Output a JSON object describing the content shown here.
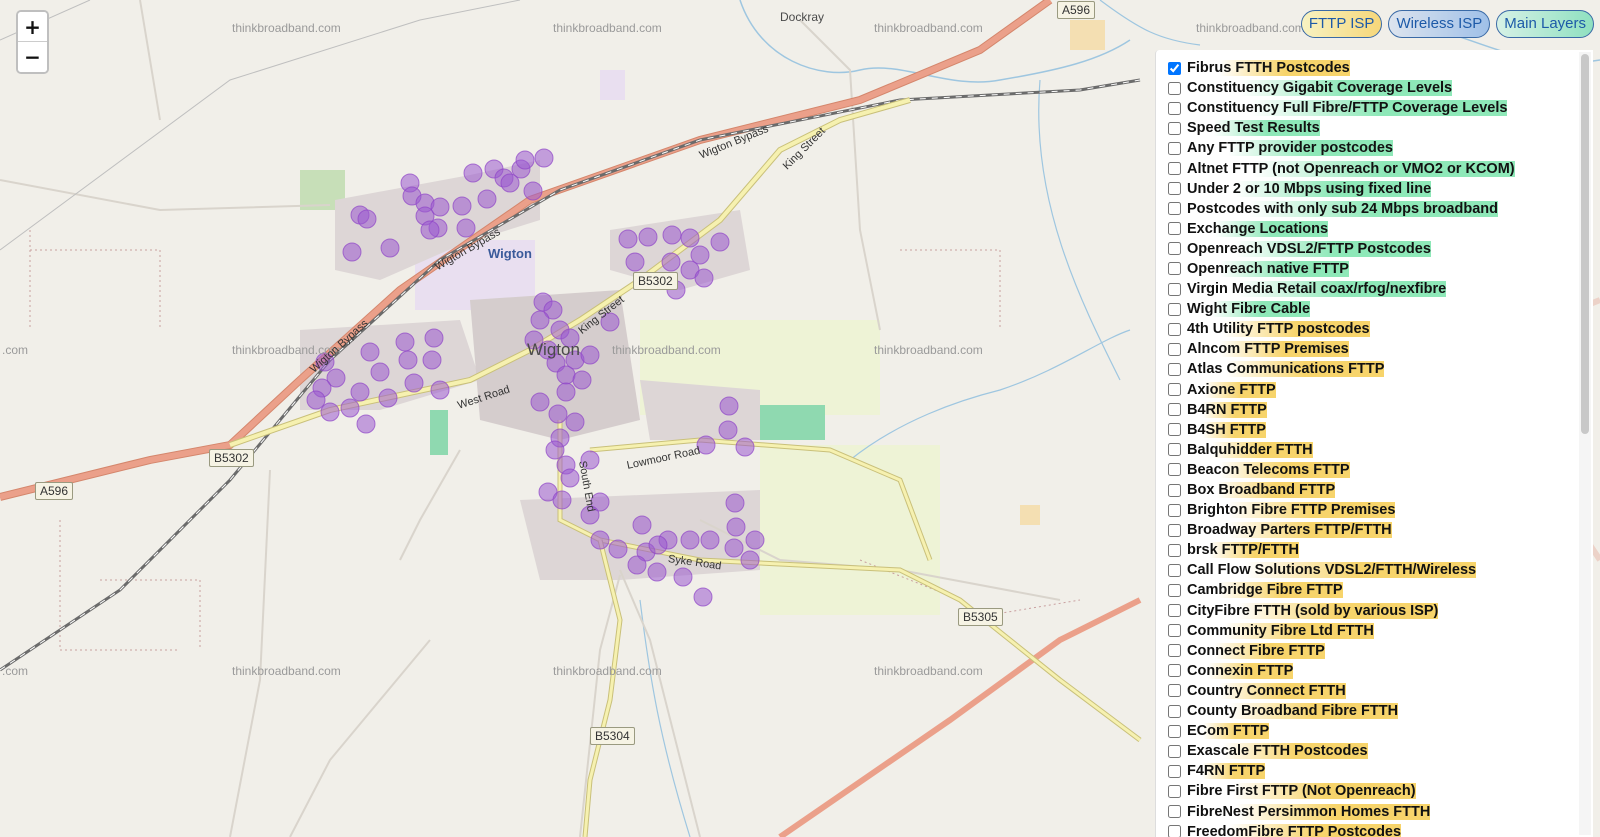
{
  "zoom": {
    "in_label": "+",
    "out_label": "−"
  },
  "tabs": [
    {
      "label": "FTTP ISP"
    },
    {
      "label": "Wireless ISP"
    },
    {
      "label": "Main Layers"
    }
  ],
  "map": {
    "watermark": "thinkbroadband.com",
    "watermark_partial": ".com",
    "places": {
      "town": "Wigton",
      "station": "Wigton",
      "dockray": "Dockray"
    },
    "roads": {
      "a596_north": "A596",
      "a596_west": "A596",
      "b5302_west": "B5302",
      "b5302_center": "B5302",
      "b5305": "B5305",
      "b5304": "B5304",
      "wigton_bypass_ne": "Wigton Bypass",
      "wigton_bypass_nw": "Wigton Bypass",
      "wigton_bypass_sw": "Wigton Bypass",
      "king_street": "King Street",
      "king_street_2": "King Street",
      "west_road": "West Road",
      "lowmoor_road": "Lowmoor Road",
      "south_end": "South End",
      "syke_road": "Syke Road"
    },
    "colors": {
      "marker": "#9b59d0",
      "road_main": "#e8937a",
      "road_minor": "#f6f1b0",
      "rail": "#6b6b6b"
    }
  },
  "layers": [
    {
      "label": "Fibrus FTTH Postcodes",
      "checked": true,
      "hl": "yellow"
    },
    {
      "label": "Constituency Gigabit Coverage Levels",
      "checked": false,
      "hl": "green"
    },
    {
      "label": "Constituency Full Fibre/FTTP Coverage Levels",
      "checked": false,
      "hl": "green"
    },
    {
      "label": "Speed Test Results",
      "checked": false,
      "hl": "green"
    },
    {
      "label": "Any FTTP provider postcodes",
      "checked": false,
      "hl": "green"
    },
    {
      "label": "Altnet FTTP (not Openreach or VMO2 or KCOM)",
      "checked": false,
      "hl": "green"
    },
    {
      "label": "Under 2 or 10 Mbps using fixed line",
      "checked": false,
      "hl": "green"
    },
    {
      "label": "Postcodes with only sub 24 Mbps broadband",
      "checked": false,
      "hl": "green"
    },
    {
      "label": "Exchange Locations",
      "checked": false,
      "hl": "green"
    },
    {
      "label": "Openreach VDSL2/FTTP Postcodes",
      "checked": false,
      "hl": "green"
    },
    {
      "label": "Openreach native FTTP",
      "checked": false,
      "hl": "green"
    },
    {
      "label": "Virgin Media Retail coax/rfog/nexfibre",
      "checked": false,
      "hl": "green"
    },
    {
      "label": "Wight Fibre Cable",
      "checked": false,
      "hl": "green"
    },
    {
      "label": "4th Utility FTTP postcodes",
      "checked": false,
      "hl": "yellow"
    },
    {
      "label": "Alncom FTTP Premises",
      "checked": false,
      "hl": "yellow"
    },
    {
      "label": "Atlas Communications FTTP",
      "checked": false,
      "hl": "yellow"
    },
    {
      "label": "Axione FTTP",
      "checked": false,
      "hl": "yellow"
    },
    {
      "label": "B4RN FTTP",
      "checked": false,
      "hl": "yellow"
    },
    {
      "label": "B4SH FTTP",
      "checked": false,
      "hl": "yellow"
    },
    {
      "label": "Balquhidder FTTH",
      "checked": false,
      "hl": "yellow"
    },
    {
      "label": "Beacon Telecoms FTTP",
      "checked": false,
      "hl": "yellow"
    },
    {
      "label": "Box Broadband FTTP",
      "checked": false,
      "hl": "yellow"
    },
    {
      "label": "Brighton Fibre FTTP Premises",
      "checked": false,
      "hl": "yellow"
    },
    {
      "label": "Broadway Parters FTTP/FTTH",
      "checked": false,
      "hl": "yellow"
    },
    {
      "label": "brsk FTTP/FTTH",
      "checked": false,
      "hl": "yellow"
    },
    {
      "label": "Call Flow Solutions VDSL2/FTTH/Wireless",
      "checked": false,
      "hl": "yellow"
    },
    {
      "label": "Cambridge Fibre FTTP",
      "checked": false,
      "hl": "yellow"
    },
    {
      "label": "CityFibre FTTH (sold by various ISP)",
      "checked": false,
      "hl": "yellow"
    },
    {
      "label": "Community Fibre Ltd FTTH",
      "checked": false,
      "hl": "yellow"
    },
    {
      "label": "Connect Fibre FTTP",
      "checked": false,
      "hl": "yellow"
    },
    {
      "label": "Connexin FTTP",
      "checked": false,
      "hl": "yellow"
    },
    {
      "label": "Country Connect FTTH",
      "checked": false,
      "hl": "yellow"
    },
    {
      "label": "County Broadband Fibre FTTH",
      "checked": false,
      "hl": "yellow"
    },
    {
      "label": "ECom FTTP",
      "checked": false,
      "hl": "yellow"
    },
    {
      "label": "Exascale FTTH Postcodes",
      "checked": false,
      "hl": "yellow"
    },
    {
      "label": "F4RN FTTP",
      "checked": false,
      "hl": "yellow"
    },
    {
      "label": "Fibre First FTTP (Not Openreach)",
      "checked": false,
      "hl": "yellow"
    },
    {
      "label": "FibreNest Persimmon Homes FTTH",
      "checked": false,
      "hl": "yellow"
    },
    {
      "label": "FreedomFibre FTTP Postcodes",
      "checked": false,
      "hl": "yellow"
    }
  ]
}
